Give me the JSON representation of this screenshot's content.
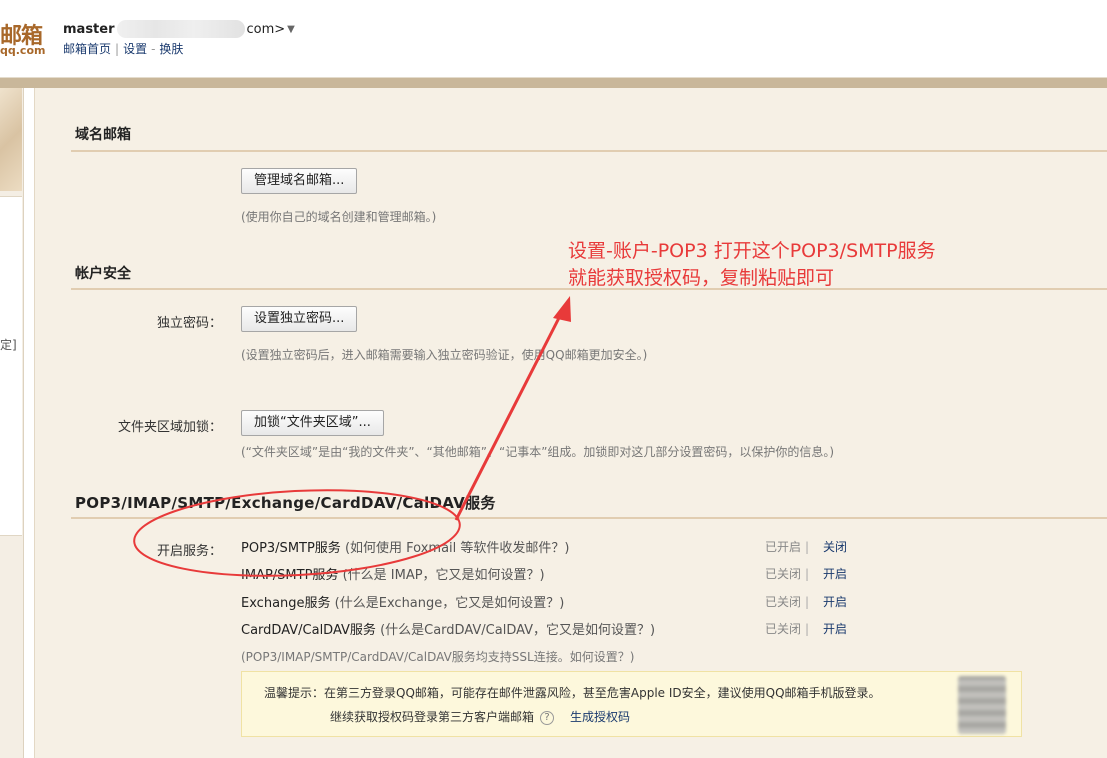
{
  "header": {
    "logo_text": "邮箱",
    "logo_url": "qq.com",
    "account_user": "master",
    "account_domain": "com>",
    "account_caret": "▼",
    "nav": {
      "home": "邮箱首页",
      "sep": "|",
      "settings": "设置",
      "dash": "-",
      "skin": "换肤"
    }
  },
  "left": {
    "glyph": "定]"
  },
  "sections": {
    "domain": {
      "title": "域名邮箱",
      "button": "管理域名邮箱...",
      "hint": "(使用你自己的域名创建和管理邮箱。)"
    },
    "security": {
      "title": "帐户安全",
      "password_label": "独立密码：",
      "password_button": "设置独立密码...",
      "password_hint": "(设置独立密码后，进入邮箱需要输入独立密码验证，使用QQ邮箱更加安全。)",
      "folder_label": "文件夹区域加锁：",
      "folder_button": "加锁“文件夹区域”...",
      "folder_hint": "(“文件夹区域”是由“我的文件夹”、“其他邮箱”、“记事本”组成。加锁即对这几部分设置密码，以保护你的信息。)"
    },
    "services": {
      "title": "POP3/IMAP/SMTP/Exchange/CardDAV/CalDAV服务",
      "label": "开启服务：",
      "items": [
        {
          "name": "POP3/SMTP服务",
          "help": "(如何使用 Foxmail 等软件收发邮件？)",
          "status": "已开启",
          "sep": "|",
          "action": "关闭"
        },
        {
          "name": "IMAP/SMTP服务",
          "help": "(什么是 IMAP，它又是如何设置？)",
          "status": "已关闭",
          "sep": "|",
          "action": "开启"
        },
        {
          "name": "Exchange服务",
          "help": "(什么是Exchange，它又是如何设置？)",
          "status": "已关闭",
          "sep": "|",
          "action": "开启"
        },
        {
          "name": "CardDAV/CalDAV服务",
          "help": "(什么是CardDAV/CalDAV，它又是如何设置？)",
          "status": "已关闭",
          "sep": "|",
          "action": "开启"
        }
      ],
      "ssl_note": "(POP3/IMAP/SMTP/CardDAV/CalDAV服务均支持SSL连接。如何设置？)"
    }
  },
  "tip": {
    "line1": "温馨提示：在第三方登录QQ邮箱，可能存在邮件泄露风险，甚至危害Apple ID安全，建议使用QQ邮箱手机版登录。",
    "line2": "继续获取授权码登录第三方客户端邮箱",
    "q": "?",
    "generate": "生成授权码"
  },
  "annotation": {
    "line1": "设置-账户-POP3 打开这个POP3/SMTP服务",
    "line2": "就能获取授权码，复制粘贴即可",
    "color": "#e83a3a"
  }
}
